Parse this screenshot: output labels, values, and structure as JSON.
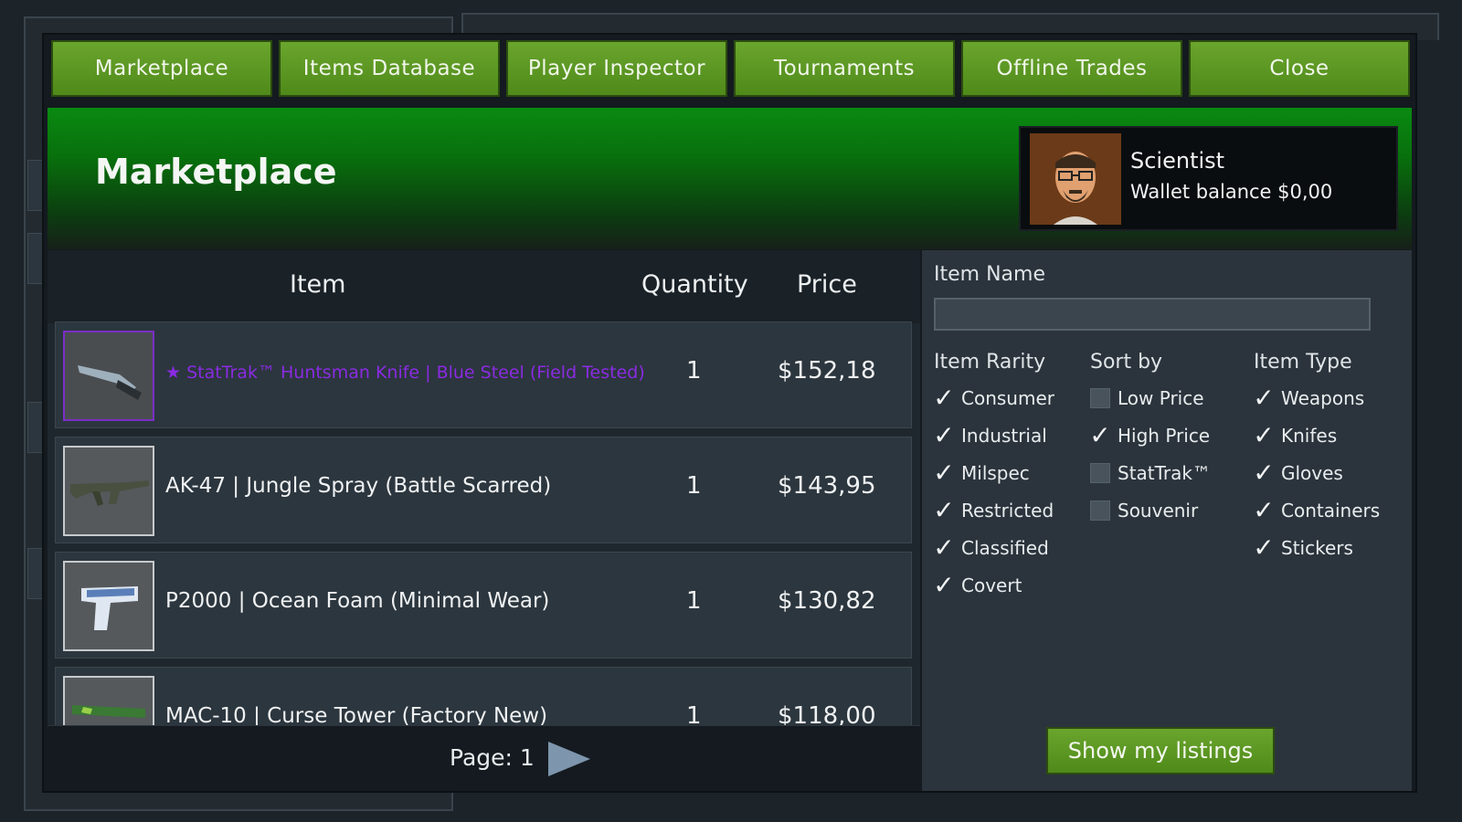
{
  "tabs": [
    "Marketplace",
    "Items Database",
    "Player Inspector",
    "Tournaments",
    "Offline Trades",
    "Close"
  ],
  "banner": {
    "title": "Marketplace"
  },
  "profile": {
    "name": "Scientist",
    "wallet": "Wallet balance $0,00"
  },
  "listings": {
    "headers": {
      "item": "Item",
      "quantity": "Quantity",
      "price": "Price"
    },
    "rows": [
      {
        "name": "★ StatTrak™ Huntsman Knife | Blue Steel (Field Tested)",
        "quantity": "1",
        "price": "$152,18",
        "rare": true
      },
      {
        "name": "AK-47 | Jungle Spray (Battle Scarred)",
        "quantity": "1",
        "price": "$143,95",
        "rare": false
      },
      {
        "name": "P2000 | Ocean Foam (Minimal Wear)",
        "quantity": "1",
        "price": "$130,82",
        "rare": false
      },
      {
        "name": "MAC-10 | Curse Tower (Factory New)",
        "quantity": "1",
        "price": "$118,00",
        "rare": false
      }
    ]
  },
  "pager": {
    "label": "Page: 1"
  },
  "filters": {
    "item_name_label": "Item Name",
    "item_name_value": "",
    "rarity": {
      "title": "Item Rarity",
      "options": [
        {
          "label": "Consumer",
          "checked": true
        },
        {
          "label": "Industrial",
          "checked": true
        },
        {
          "label": "Milspec",
          "checked": true
        },
        {
          "label": "Restricted",
          "checked": true
        },
        {
          "label": "Classified",
          "checked": true
        },
        {
          "label": "Covert",
          "checked": true
        }
      ]
    },
    "sort": {
      "title": "Sort by",
      "options": [
        {
          "label": "Low Price",
          "checked": false
        },
        {
          "label": "High Price",
          "checked": true
        },
        {
          "label": "StatTrak™",
          "checked": false
        },
        {
          "label": "Souvenir",
          "checked": false
        }
      ]
    },
    "type": {
      "title": "Item Type",
      "options": [
        {
          "label": "Weapons",
          "checked": true
        },
        {
          "label": "Knifes",
          "checked": true
        },
        {
          "label": "Gloves",
          "checked": true
        },
        {
          "label": "Containers",
          "checked": true
        },
        {
          "label": "Stickers",
          "checked": true
        }
      ]
    },
    "show_listings_label": "Show my listings"
  },
  "colors": {
    "tab_green": "#5a9622",
    "banner_green": "#0a8a12",
    "rare_purple": "#8a2be2",
    "arrow_blue": "#7d95ad"
  }
}
